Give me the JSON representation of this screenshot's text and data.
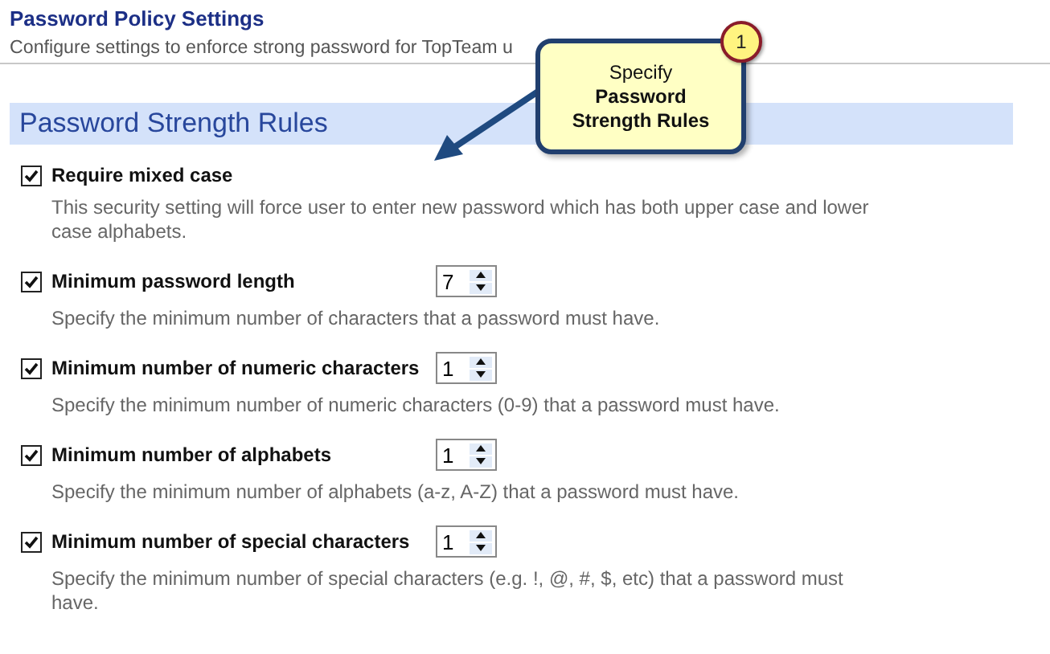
{
  "header": {
    "title": "Password Policy Settings",
    "subtitle": "Configure settings to enforce strong password for TopTeam u"
  },
  "section": {
    "title": "Password Strength Rules"
  },
  "rules": [
    {
      "kind": "checkbox",
      "label": "Require mixed case",
      "checked": true,
      "description": "This security setting will force user to enter new password which has both upper case and lower case alphabets."
    },
    {
      "kind": "spinner",
      "label": "Minimum password length",
      "checked": true,
      "value": "7",
      "description": "Specify the minimum number of characters that a password must have."
    },
    {
      "kind": "spinner",
      "label": "Minimum number of numeric characters",
      "checked": true,
      "value": "1",
      "description": "Specify the minimum number of numeric characters (0-9) that a password must have."
    },
    {
      "kind": "spinner",
      "label": "Minimum number of alphabets",
      "checked": true,
      "value": "1",
      "description": "Specify the minimum number of alphabets (a-z, A-Z) that a password must have."
    },
    {
      "kind": "spinner",
      "label": "Minimum number of special characters",
      "checked": true,
      "value": "1",
      "description": "Specify the minimum number of special characters (e.g. !, @, #, $, etc) that a password must have."
    }
  ],
  "callout": {
    "badge": "1",
    "lines": [
      "Specify",
      "**Password**",
      "**Strength Rules**"
    ]
  }
}
